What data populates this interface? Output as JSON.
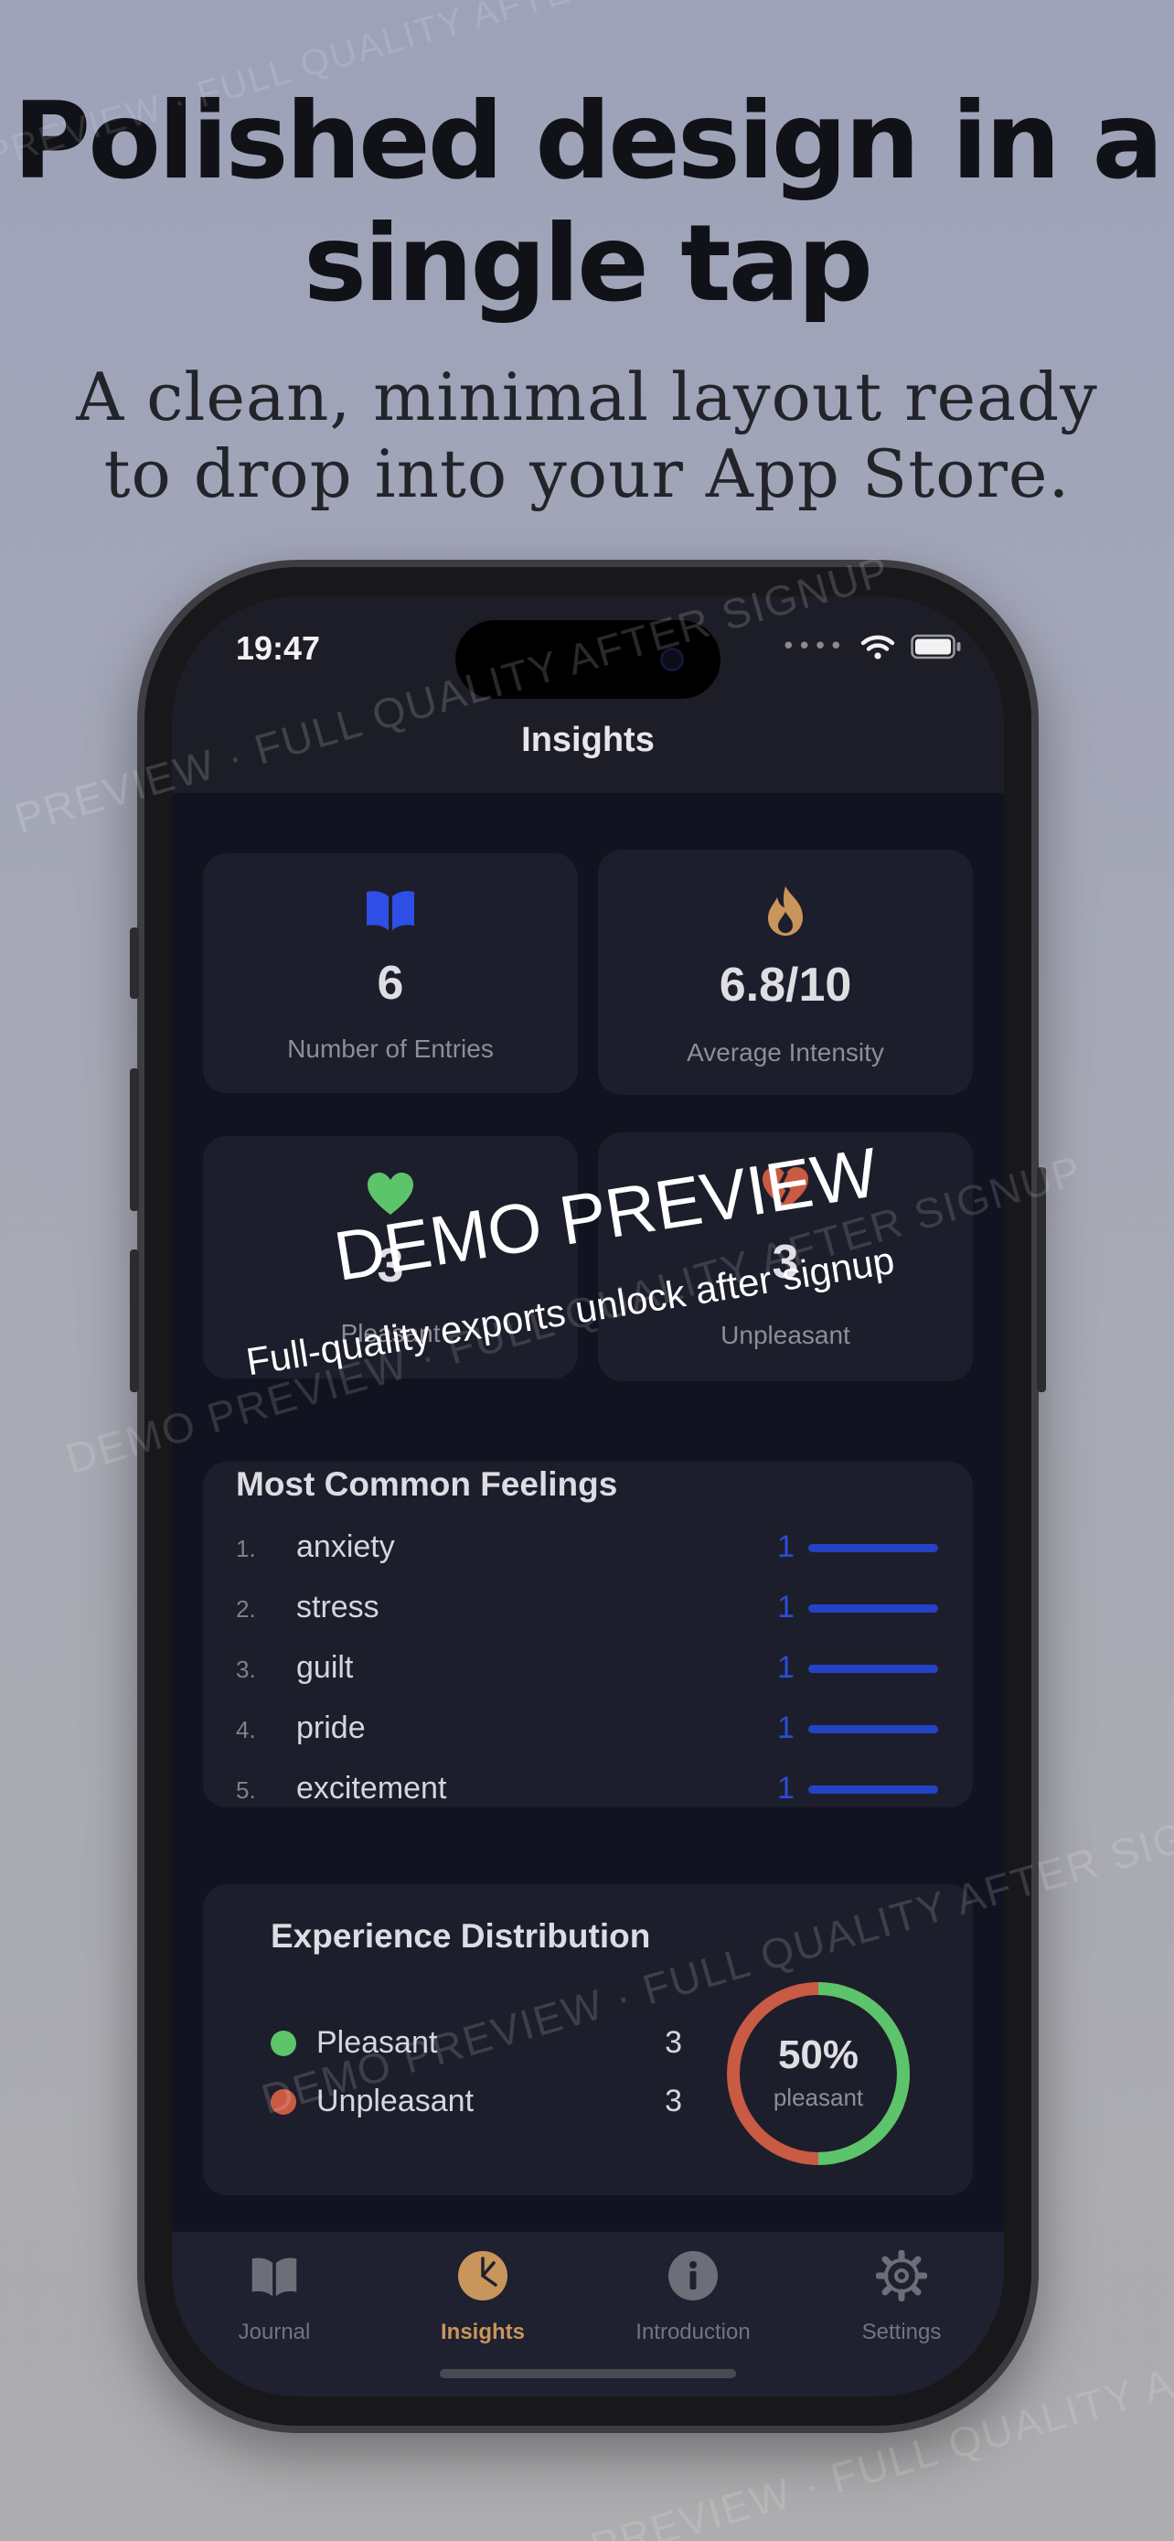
{
  "marketing": {
    "headline_line1": "Polished design in a",
    "headline_line2": "single tap",
    "subline_line1": "A clean, minimal layout ready",
    "subline_line2": "to drop into your App Store."
  },
  "status_bar": {
    "time": "19:47"
  },
  "nav": {
    "title": "Insights"
  },
  "stats": [
    {
      "icon": "book-icon",
      "value": "6",
      "label": "Number of Entries",
      "color": "#2f4ee6"
    },
    {
      "icon": "flame-icon",
      "value": "6.8/10",
      "label": "Average Intensity",
      "color": "#c8955a"
    },
    {
      "icon": "heart-icon",
      "value": "3",
      "label": "Pleasant",
      "color": "#5cc46a"
    },
    {
      "icon": "broken-heart-icon",
      "value": "3",
      "label": "Unpleasant",
      "color": "#c95a44"
    }
  ],
  "feelings": {
    "title": "Most Common Feelings",
    "items": [
      {
        "rank": "1.",
        "name": "anxiety",
        "count": "1",
        "fraction": 1.0
      },
      {
        "rank": "2.",
        "name": "stress",
        "count": "1",
        "fraction": 1.0
      },
      {
        "rank": "3.",
        "name": "guilt",
        "count": "1",
        "fraction": 1.0
      },
      {
        "rank": "4.",
        "name": "pride",
        "count": "1",
        "fraction": 1.0
      },
      {
        "rank": "5.",
        "name": "excitement",
        "count": "1",
        "fraction": 1.0
      }
    ]
  },
  "distribution": {
    "title": "Experience Distribution",
    "items": [
      {
        "label": "Pleasant",
        "count": "3",
        "color": "#5cc46a"
      },
      {
        "label": "Unpleasant",
        "count": "3",
        "color": "#c95a44"
      }
    ],
    "percent": "50%",
    "percent_label": "pleasant",
    "pleasant_fraction": 0.5
  },
  "tabs": [
    {
      "label": "Journal",
      "icon": "book-icon",
      "active": false
    },
    {
      "label": "Insights",
      "icon": "pie-chart-icon",
      "active": true
    },
    {
      "label": "Introduction",
      "icon": "info-icon",
      "active": false
    },
    {
      "label": "Settings",
      "icon": "gear-icon",
      "active": false
    }
  ],
  "watermark": {
    "demo_title": "DEMO PREVIEW",
    "demo_subtitle": "Full-quality exports unlock after signup",
    "repeat_text": "PREVIEW · FULL QUALITY AFTER SIGNUP",
    "repeat_text_2": "DEMO PREVIEW · FULL QUALITY AFTER SIGNUP"
  },
  "colors": {
    "accent_active_tab": "#c8955a",
    "feeling_bar": "#2442c4",
    "card_bg": "#1d1e2b"
  }
}
